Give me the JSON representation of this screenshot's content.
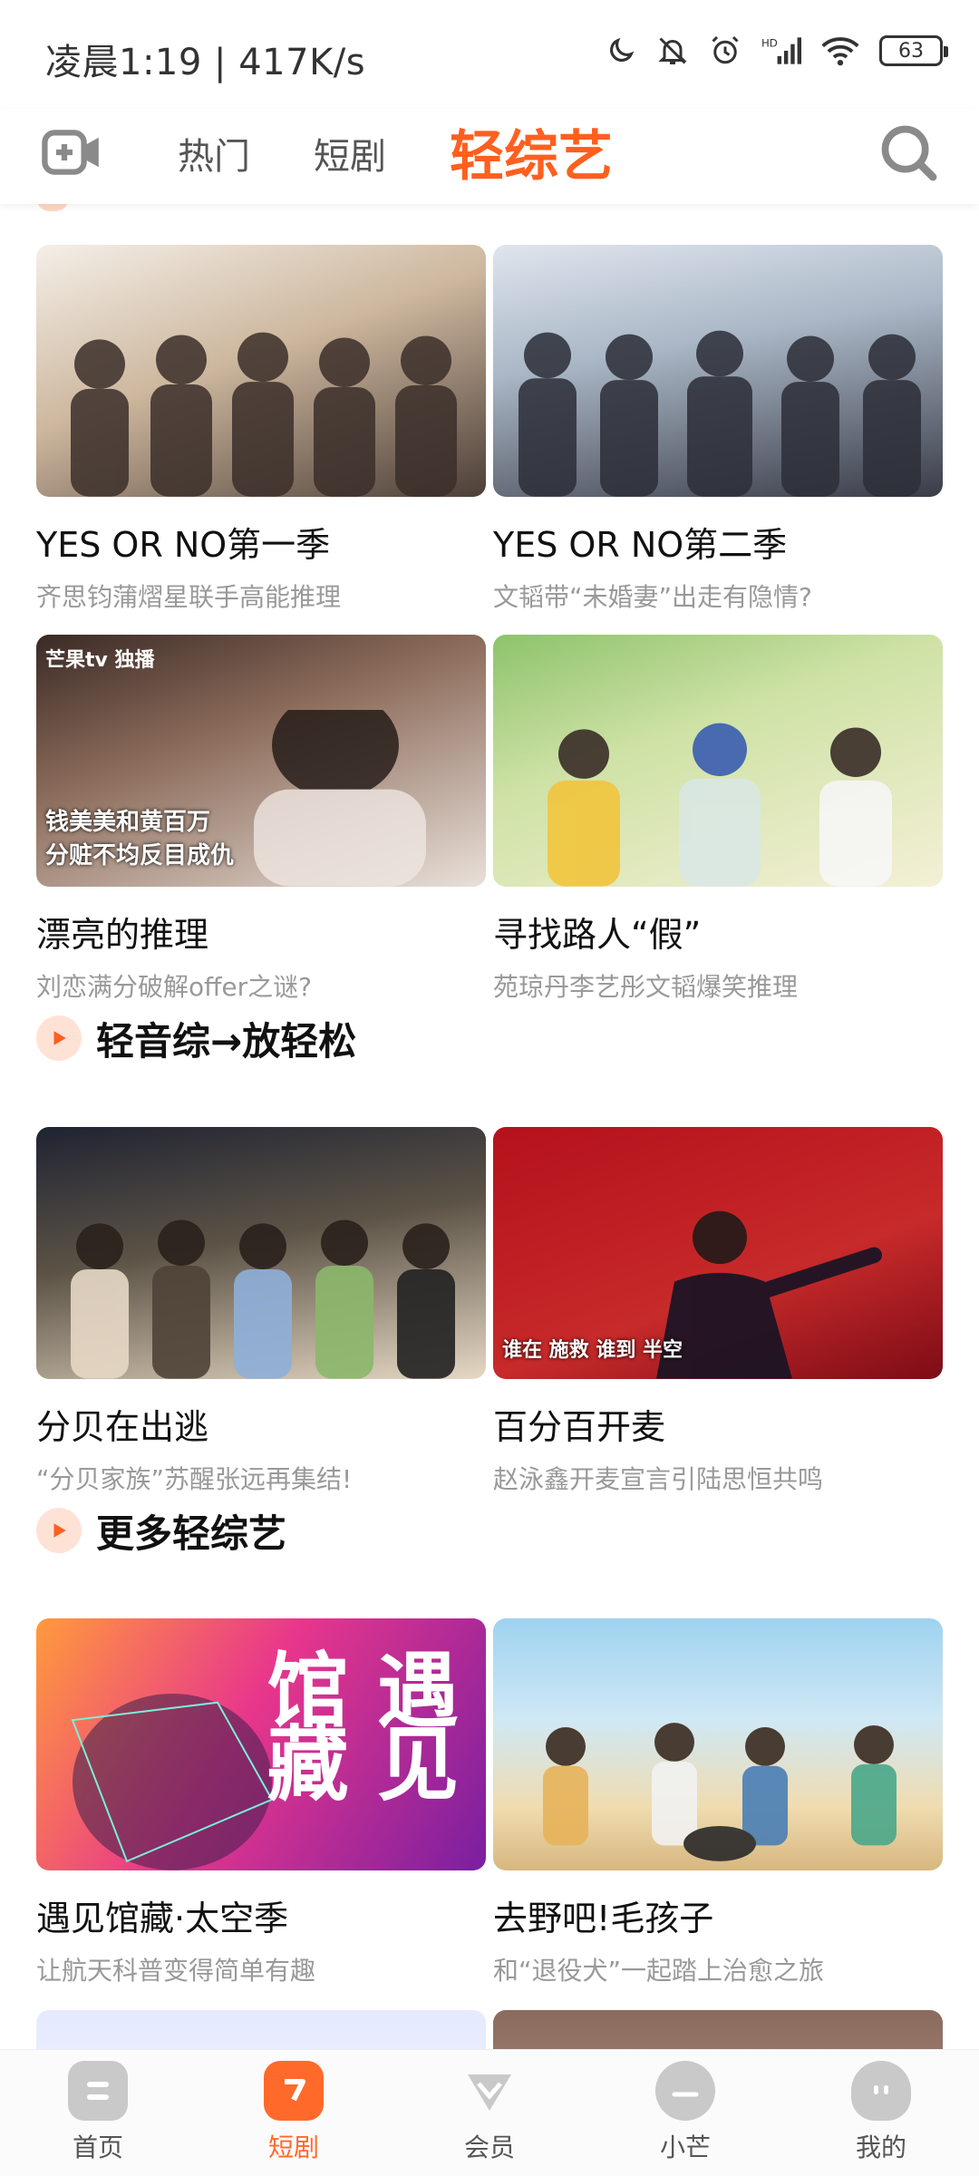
{
  "status_bar": {
    "time_speed": "凌晨1:19 | 417K/s",
    "battery": "63"
  },
  "top_nav": {
    "tabs": [
      {
        "label": "热门"
      },
      {
        "label": "短剧"
      },
      {
        "label": "轻综艺"
      }
    ],
    "active_tab": "轻综艺",
    "accent_color": "#ff5f1f"
  },
  "sections": [
    {
      "title": "",
      "cards": [
        {
          "title": "YES OR NO第一季",
          "subtitle": "齐思钧蒲熠星联手高能推理"
        },
        {
          "title": "YES OR NO第二季",
          "subtitle": "文韬带“未婚妻”出走有隐情?"
        },
        {
          "title": "漂亮的推理",
          "subtitle": "刘恋满分破解offer之谜?",
          "overlay": "钱美美和黄百万\n分赃不均反目成仇",
          "badge": "芒果tv 独播"
        },
        {
          "title": "寻找路人“假”",
          "subtitle": "苑琼丹李艺彤文韬爆笑推理"
        }
      ]
    },
    {
      "title": "轻音综→放轻松",
      "cards": [
        {
          "title": "分贝在出逃",
          "subtitle": "“分贝家族”苏醒张远再集结!"
        },
        {
          "title": "百分百开麦",
          "subtitle": "赵泳鑫开麦宣言引陆思恒共鸣",
          "overlay": "谁在  施救  谁到  半空"
        }
      ]
    },
    {
      "title": "更多轻综艺",
      "cards": [
        {
          "title": "遇见馆藏·太空季",
          "subtitle": "让航天科普变得简单有趣",
          "big_text": "馆 遇\n藏 见"
        },
        {
          "title": "去野吧!毛孩子",
          "subtitle": "和“退役犬”一起踏上治愈之旅"
        }
      ]
    }
  ],
  "bottom_nav": [
    {
      "label": "首页",
      "icon": "home-icon"
    },
    {
      "label": "短剧",
      "icon": "short-drama-icon",
      "active": true
    },
    {
      "label": "会员",
      "icon": "vip-icon"
    },
    {
      "label": "小芒",
      "icon": "xiaomang-icon"
    },
    {
      "label": "我的",
      "icon": "profile-icon"
    }
  ]
}
